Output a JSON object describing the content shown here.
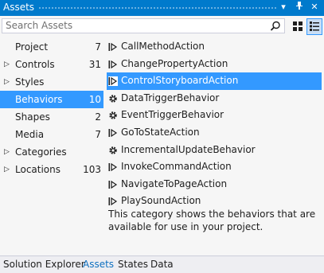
{
  "window": {
    "title": "Assets"
  },
  "search": {
    "placeholder": "Search Assets"
  },
  "categories": [
    {
      "label": "Project",
      "count": "7",
      "expander": false
    },
    {
      "label": "Controls",
      "count": "31",
      "expander": true
    },
    {
      "label": "Styles",
      "count": "",
      "expander": true
    },
    {
      "label": "Behaviors",
      "count": "10",
      "expander": false,
      "selected": true
    },
    {
      "label": "Shapes",
      "count": "2",
      "expander": false
    },
    {
      "label": "Media",
      "count": "7",
      "expander": false
    },
    {
      "label": "Categories",
      "count": "",
      "expander": true
    },
    {
      "label": "Locations",
      "count": "103",
      "expander": true
    }
  ],
  "behaviors": [
    {
      "label": "CallMethodAction",
      "icon": "action-icon"
    },
    {
      "label": "ChangePropertyAction",
      "icon": "action-icon"
    },
    {
      "label": "ControlStoryboardAction",
      "icon": "action-icon",
      "selected": true
    },
    {
      "label": "DataTriggerBehavior",
      "icon": "gear-icon"
    },
    {
      "label": "EventTriggerBehavior",
      "icon": "gear-icon"
    },
    {
      "label": "GoToStateAction",
      "icon": "action-icon"
    },
    {
      "label": "IncrementalUpdateBehavior",
      "icon": "gear-icon"
    },
    {
      "label": "InvokeCommandAction",
      "icon": "action-icon"
    },
    {
      "label": "NavigateToPageAction",
      "icon": "action-icon"
    },
    {
      "label": "PlaySoundAction",
      "icon": "action-icon"
    }
  ],
  "description": "This category shows the behaviors that are available for use in your project.",
  "tabs": [
    {
      "label": "Solution Explorer"
    },
    {
      "label": "Assets",
      "active": true
    },
    {
      "label": "States"
    },
    {
      "label": "Data"
    }
  ],
  "colors": {
    "accent": "#007acc",
    "selection": "#3399ff",
    "active_tab_text": "#0e70c0"
  }
}
